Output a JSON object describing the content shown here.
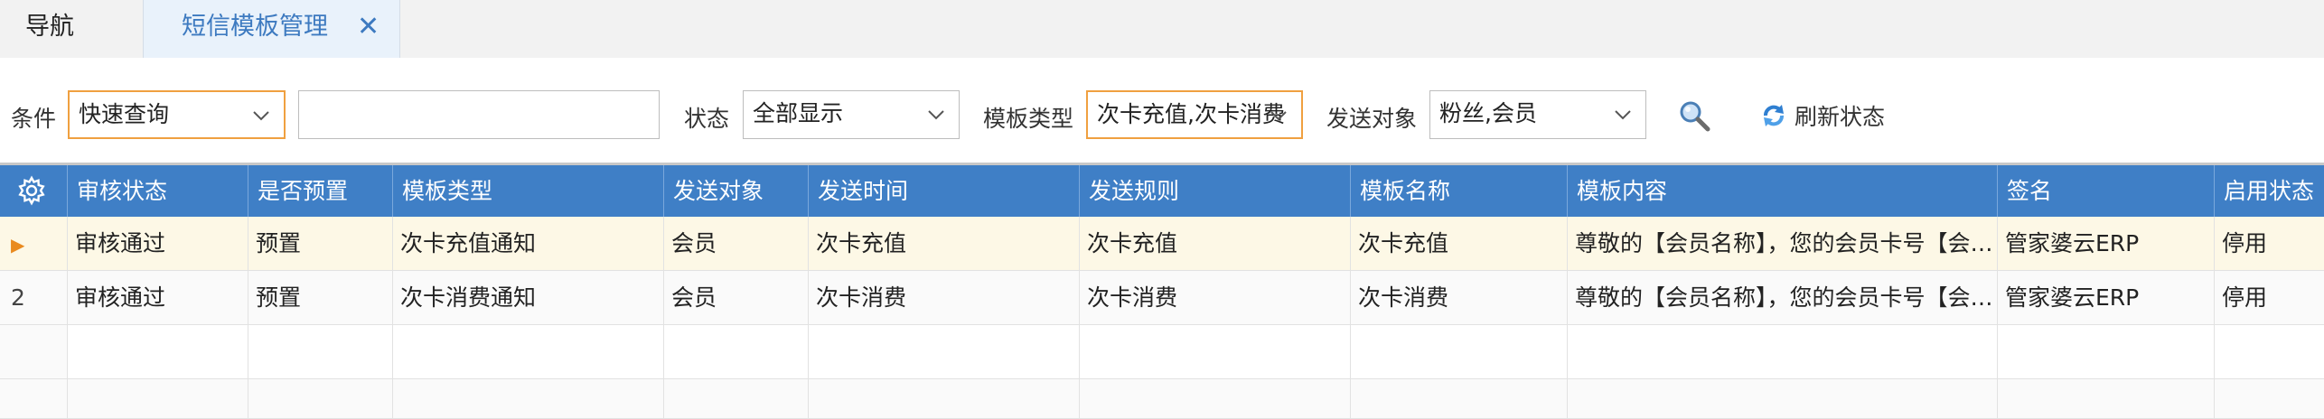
{
  "tabs": {
    "nav_label": "导航",
    "active_label": "短信模板管理",
    "close_glyph": "✕"
  },
  "filters": {
    "condition_label": "条件",
    "condition_value": "快速查询",
    "keyword_value": "",
    "status_label": "状态",
    "status_value": "全部显示",
    "template_type_label": "模板类型",
    "template_type_value": "次卡充值,次卡消费",
    "send_target_label": "发送对象",
    "send_target_value": "粉丝,会员",
    "search_icon": "magnifier-icon",
    "refresh_label": "刷新状态",
    "refresh_icon": "refresh-icon"
  },
  "grid": {
    "settings_icon": "gear-icon",
    "columns": [
      "审核状态",
      "是否预置",
      "模板类型",
      "发送对象",
      "发送时间",
      "发送规则",
      "模板名称",
      "模板内容",
      "签名",
      "启用状态"
    ],
    "rows": [
      {
        "marker": "▶",
        "cells": [
          "审核通过",
          "预置",
          "次卡充值通知",
          "会员",
          "次卡充值",
          "次卡充值",
          "次卡充值",
          "尊敬的【会员名称】，您的会员卡号【会员卡号】",
          "管家婆云ERP",
          "停用"
        ]
      },
      {
        "marker": "2",
        "cells": [
          "审核通过",
          "预置",
          "次卡消费通知",
          "会员",
          "次卡消费",
          "次卡消费",
          "次卡消费",
          "尊敬的【会员名称】，您的会员卡号【会员卡号】",
          "管家婆云ERP",
          "停用"
        ]
      }
    ]
  },
  "colors": {
    "header_bg": "#3f7fc6",
    "selected_row_bg": "#fdf8e6",
    "accent_orange": "#f0a040",
    "tab_active_text": "#3d7ac0"
  }
}
